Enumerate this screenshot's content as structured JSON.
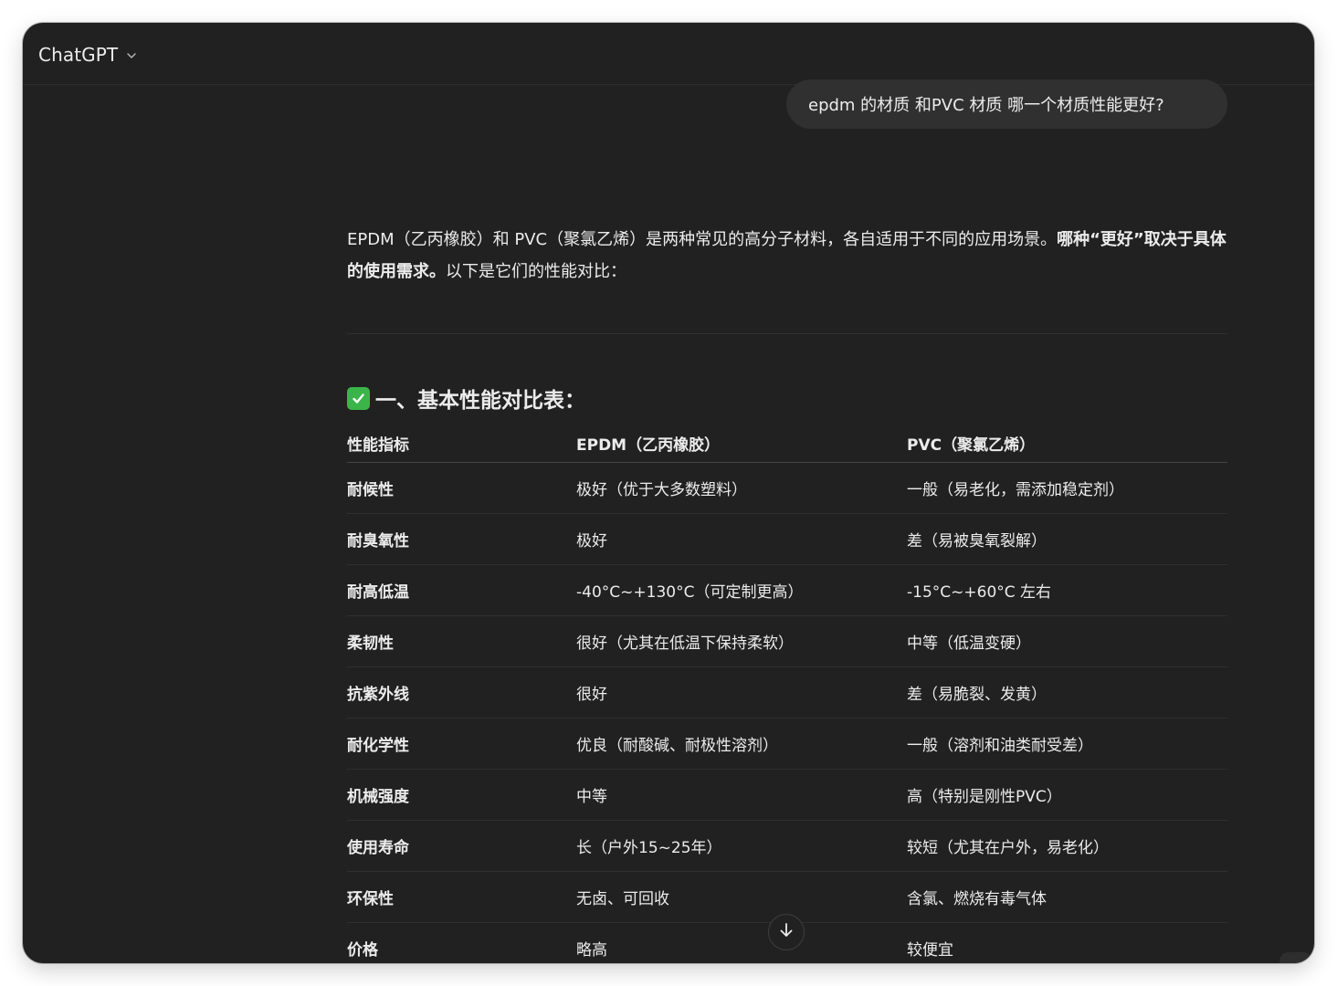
{
  "header": {
    "model_name": "ChatGPT"
  },
  "conversation": {
    "user_message": "epdm 的材质 和PVC 材质 哪一个材质性能更好?",
    "assistant": {
      "intro_plain": "EPDM（乙丙橡胶）和 PVC（聚氯乙烯）是两种常见的高分子材料，各自适用于不同的应用场景。",
      "intro_bold": "哪种“更好”取决于具体的使用需求。",
      "intro_tail": "以下是它们的性能对比：",
      "section_icon": "check-mark-button-emoji",
      "section_title": "一、基本性能对比表：",
      "table": {
        "headers": [
          "性能指标",
          "EPDM（乙丙橡胶）",
          "PVC（聚氯乙烯）"
        ],
        "rows": [
          [
            "耐候性",
            "极好（优于大多数塑料）",
            "一般（易老化，需添加稳定剂）"
          ],
          [
            "耐臭氧性",
            "极好",
            "差（易被臭氧裂解）"
          ],
          [
            "耐高低温",
            "-40°C~+130°C（可定制更高）",
            "-15°C~+60°C 左右"
          ],
          [
            "柔韧性",
            "很好（尤其在低温下保持柔软）",
            "中等（低温变硬）"
          ],
          [
            "抗紫外线",
            "很好",
            "差（易脆裂、发黄）"
          ],
          [
            "耐化学性",
            "优良（耐酸碱、耐极性溶剂）",
            "一般（溶剂和油类耐受差）"
          ],
          [
            "机械强度",
            "中等",
            "高（特别是刚性PVC）"
          ],
          [
            "使用寿命",
            "长（户外15~25年）",
            "较短（尤其在户外，易老化）"
          ],
          [
            "环保性",
            "无卤、可回收",
            "含氯、燃烧有毒气体"
          ],
          [
            "价格",
            "略高",
            "较便宜"
          ]
        ]
      }
    }
  },
  "controls": {
    "scroll_down_icon": "arrow-down-icon",
    "model_chevron_icon": "chevron-down-icon"
  },
  "colors": {
    "background": "#212121",
    "bubble": "#303030",
    "text": "#ececec",
    "check": "#3bb54a"
  }
}
